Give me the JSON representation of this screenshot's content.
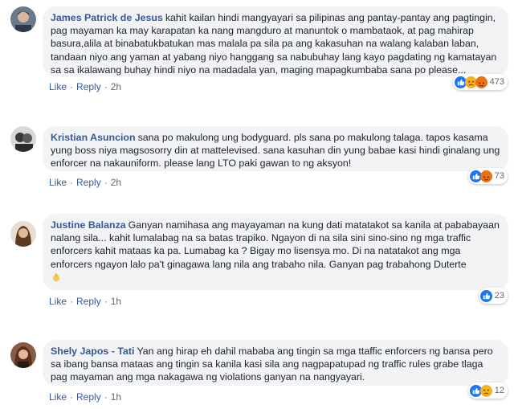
{
  "comments": [
    {
      "author": "James Patrick de Jesus",
      "text": "kahit kailan hindi mangyayari sa pilipinas ang pantay-pantay ang pagtingin, pag mayaman ka may karapatan ka nang mangduro at manuntok o mambataok, at pag mahirap basura,alila at binabatukbatukan mas malala pa sila pa ang kakasuhan na walang kalaban laban, tandaan niyo ang yaman at yabang niyo hanggang sa nabubuhay lang kayo pagdating ng kamatayan sa sa ikalawang buhay hindi niyo na madadala yan, maging mapagkumbaba sana po please...",
      "like_label": "Like",
      "reply_label": "Reply",
      "time": "2h",
      "reaction_count": "473",
      "reaction_icons": [
        "like-icon",
        "sad-icon",
        "angry-icon"
      ]
    },
    {
      "author": "Kristian Asuncion",
      "text": "sana po makulong ung bodyguard. pls sana po makulong talaga. tapos kasama yung boss niya magsosorry din at mattelevised. sana kasuhan din yung babae kasi hindi ginalang ung enforcer na nakauniform. please lang LTO paki gawan to ng aksyon!",
      "like_label": "Like",
      "reply_label": "Reply",
      "time": "2h",
      "reaction_count": "73",
      "reaction_icons": [
        "like-icon",
        "angry-icon"
      ]
    },
    {
      "author": "Justine Balanza",
      "text": "Ganyan namihasa ang mayayaman na kung dati matatakot sa kanila at pababayaan nalang sila... kahit lumalabag na sa batas trapiko. Ngayon di na sila sini sino-sino ng mga traffic enforcers kahit mataas ka pa. Lumabag ka ? Bigay mo lisensya mo. Di na natatakot ang mga enforcers ngayon lalo pa't ginagawa lang nila ang trabaho nila. Ganyan pag trabahong Duterte",
      "like_label": "Like",
      "reply_label": "Reply",
      "time": "1h",
      "reaction_count": "23",
      "reaction_icons": [
        "like-icon"
      ]
    },
    {
      "author": "Shely Japos - Tati",
      "text": "Yan ang hirap eh dahil mababa ang tingin sa mga ttaffic enforcers ng bansa pero sa ibang bansa mataas ang tingin sa kanila kasi sila ang nagpapatupad ng traffic rules grabe tlaga pag mayaman ang mga nakagawa ng violations ganyan na nangyayari.",
      "like_label": "Like",
      "reply_label": "Reply",
      "time": "1h",
      "reaction_count": "12",
      "reaction_icons": [
        "like-icon",
        "sad-icon"
      ]
    }
  ],
  "colors": {
    "author": "#385898",
    "bubble": "#f2f3f5",
    "like": "#1877f2",
    "angry": "#e9710f",
    "sad": "#f7b125"
  }
}
